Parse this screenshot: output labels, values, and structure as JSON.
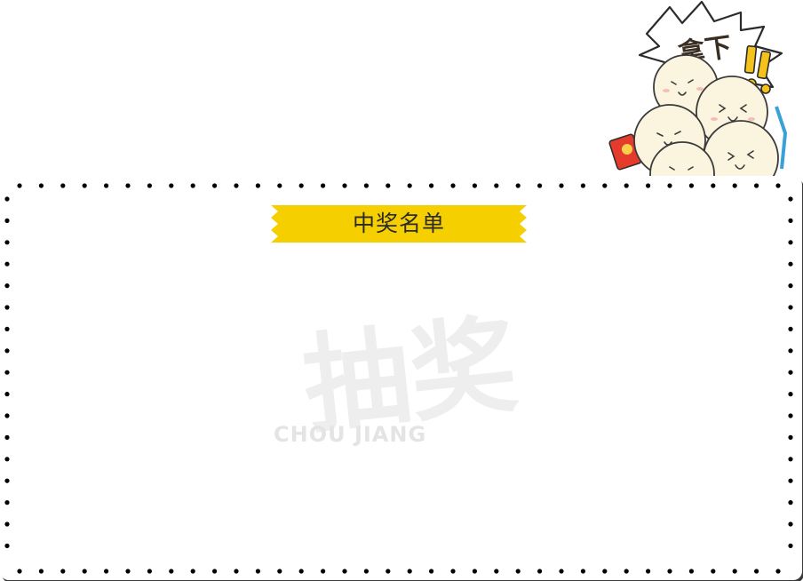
{
  "panel": {
    "title": "中奖名单"
  },
  "sticker": {
    "text": "拿下"
  },
  "watermark": {
    "main": "抽奖",
    "sub": "CHOU JIANG"
  },
  "colors": {
    "ribbon": "#f5cf00",
    "dots": "#000000",
    "watermark": "#eeeeee",
    "mascot_face": "#fbf4df",
    "red_packet": "#e53b2c"
  }
}
